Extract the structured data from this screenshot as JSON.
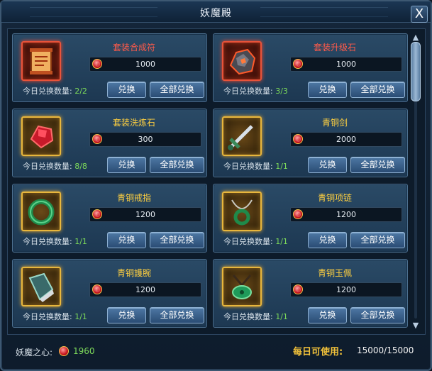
{
  "window": {
    "title": "妖魔殿",
    "close_label": "X"
  },
  "labels": {
    "daily_count": "今日兑换数量:",
    "exchange": "兑换",
    "exchange_all": "全部兑换"
  },
  "items": [
    {
      "name": "套装合成符",
      "name_color": "#ff5a4a",
      "price": "1000",
      "count": "2/2",
      "icon": "scroll-icon",
      "frame": "red"
    },
    {
      "name": "套装升级石",
      "name_color": "#ff5a4a",
      "price": "1000",
      "count": "3/3",
      "icon": "ore-stone-icon",
      "frame": "red"
    },
    {
      "name": "套装洗炼石",
      "name_color": "#ffd040",
      "price": "300",
      "count": "8/8",
      "icon": "red-crystal-icon",
      "frame": "gold"
    },
    {
      "name": "青铜剑",
      "name_color": "#ffd040",
      "price": "2000",
      "count": "1/1",
      "icon": "dagger-icon",
      "frame": "gold"
    },
    {
      "name": "青铜戒指",
      "name_color": "#ffd040",
      "price": "1200",
      "count": "1/1",
      "icon": "ring-icon",
      "frame": "gold"
    },
    {
      "name": "青铜项链",
      "name_color": "#ffd040",
      "price": "1200",
      "count": "1/1",
      "icon": "necklace-icon",
      "frame": "gold"
    },
    {
      "name": "青铜護腕",
      "name_color": "#ffd040",
      "price": "1200",
      "count": "1/1",
      "icon": "bracer-icon",
      "frame": "gold"
    },
    {
      "name": "青铜玉佩",
      "name_color": "#ffd040",
      "price": "1200",
      "count": "1/1",
      "icon": "jade-pendant-icon",
      "frame": "gold"
    }
  ],
  "footer": {
    "currency_label": "妖魔之心:",
    "currency_value": "1960",
    "daily_label": "每日可使用:",
    "daily_value": "15000/15000"
  }
}
